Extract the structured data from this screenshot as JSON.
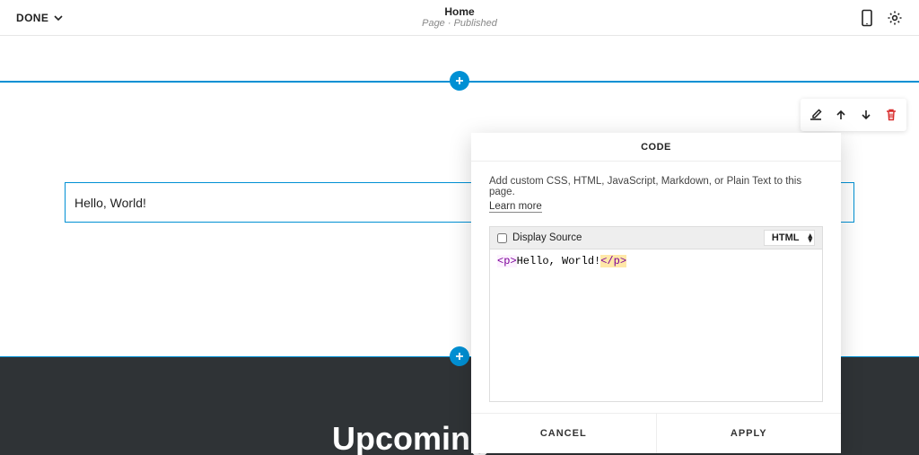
{
  "topbar": {
    "done_label": "DONE",
    "title": "Home",
    "subtitle": "Page · Published"
  },
  "block": {
    "preview_text": "Hello, World!"
  },
  "dark_section": {
    "heading": "Upcoming Dates"
  },
  "code_panel": {
    "header": "CODE",
    "description": "Add custom CSS, HTML, JavaScript, Markdown, or Plain Text to this page.",
    "learn_more": "Learn more",
    "display_source_label": "Display Source",
    "type_selected": "HTML",
    "code_tokens": {
      "open_tag": "<p>",
      "text": "Hello, World!",
      "close_tag": "</p>"
    },
    "cancel_label": "CANCEL",
    "apply_label": "APPLY"
  }
}
